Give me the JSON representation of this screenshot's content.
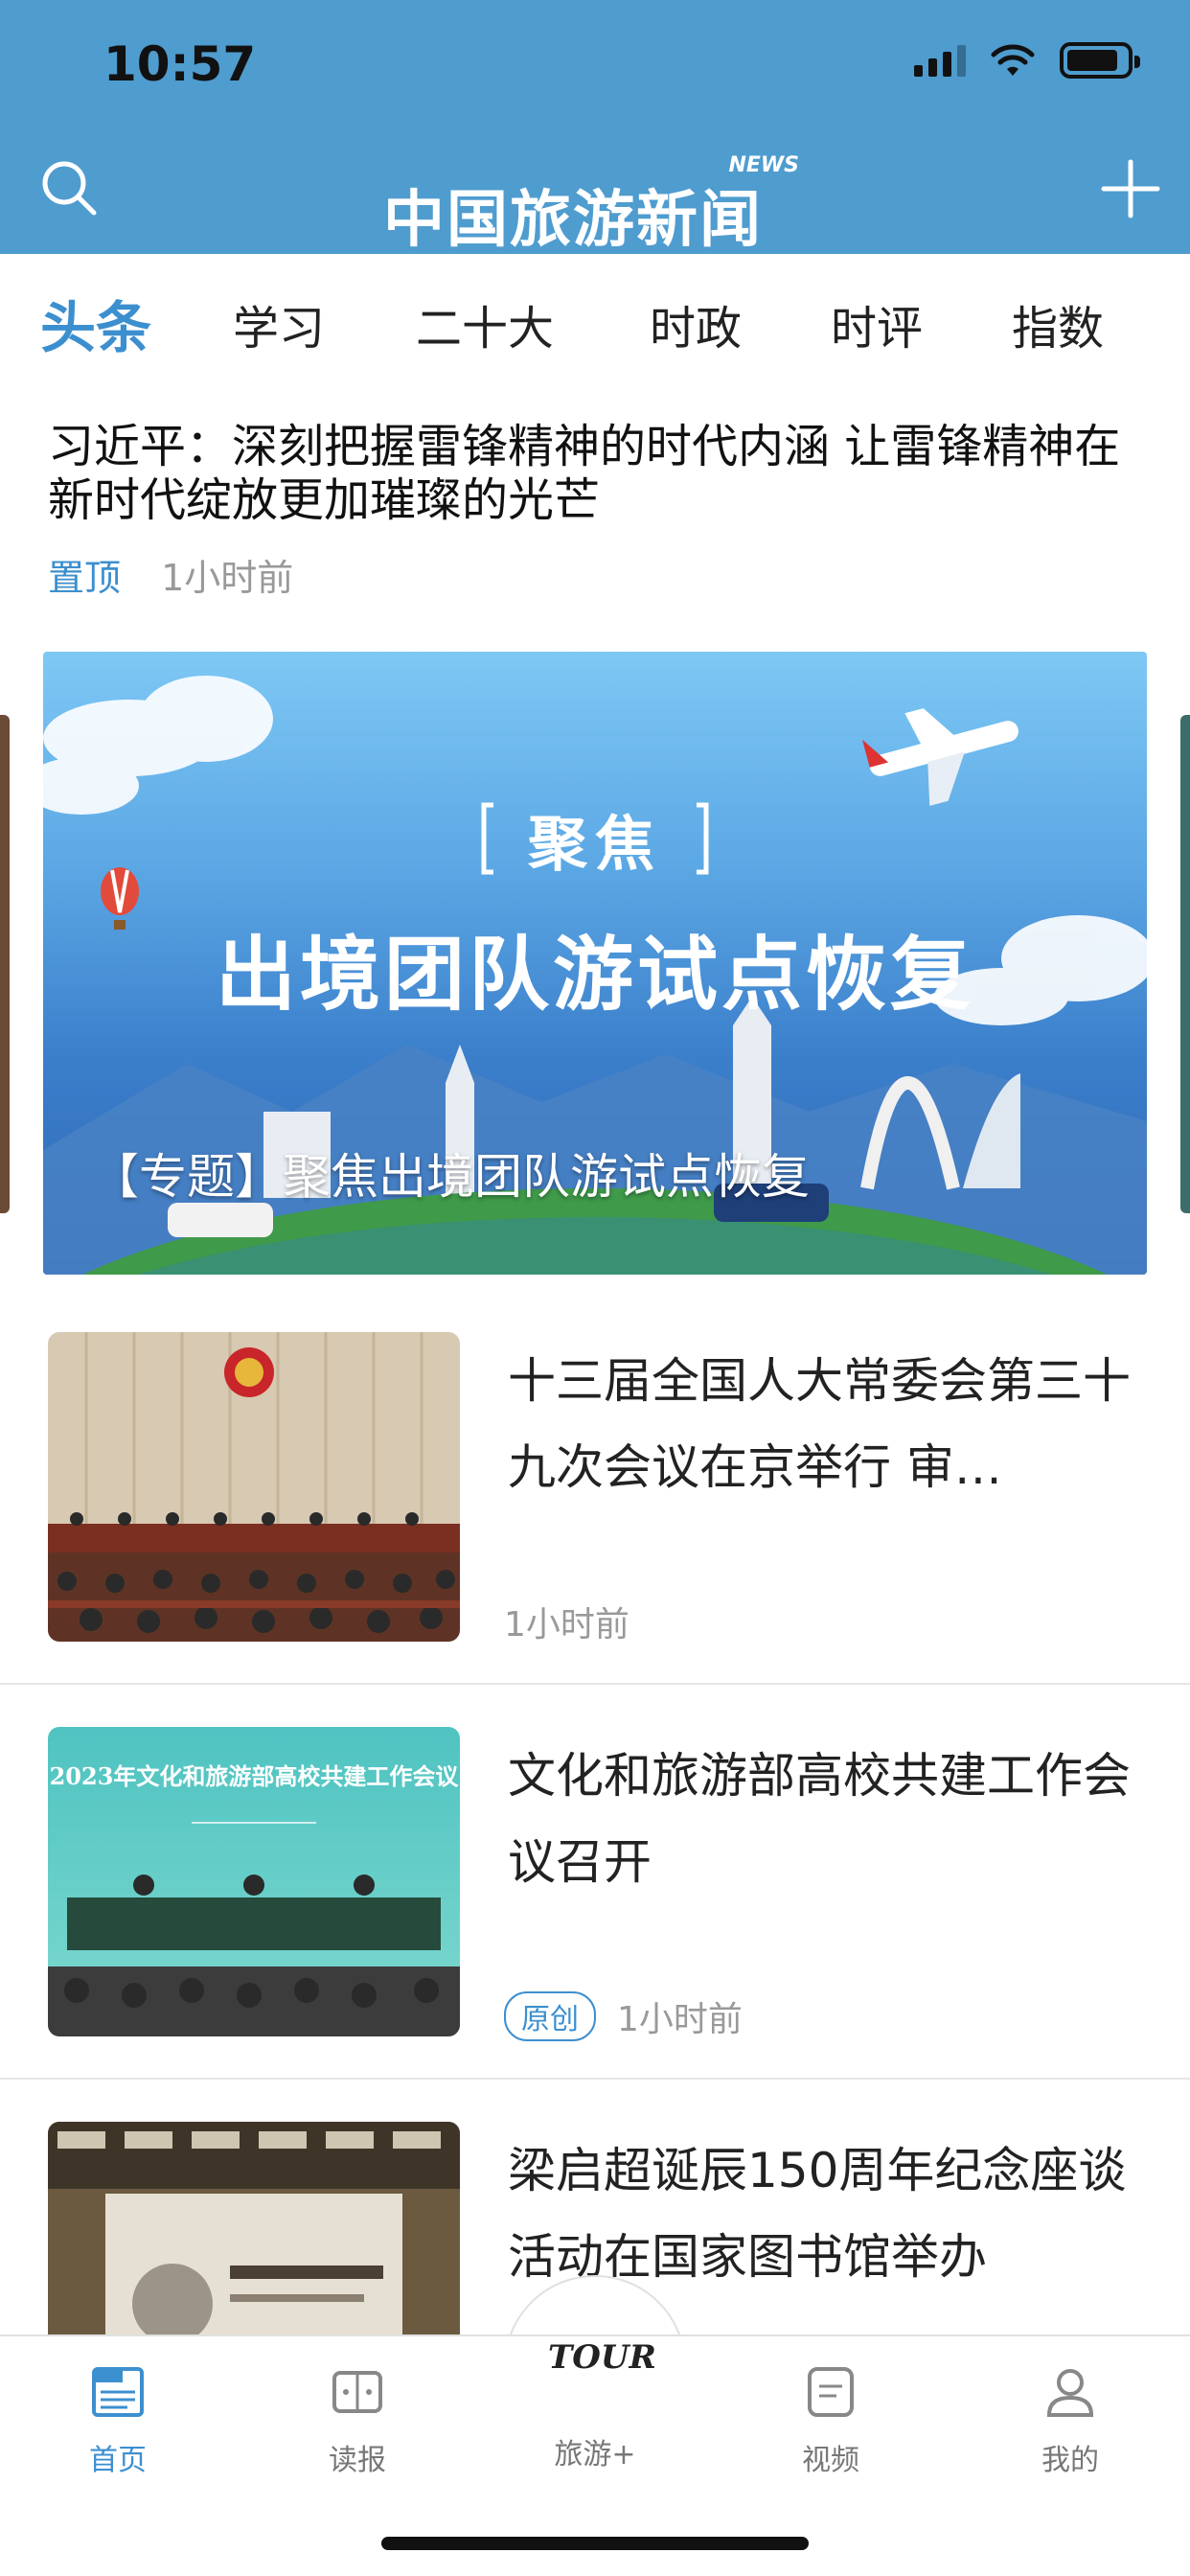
{
  "status_bar": {
    "time": "10:57"
  },
  "header": {
    "logo_text": "中国旅游新闻",
    "logo_badge": "NEWS"
  },
  "tabs": [
    "头条",
    "学习",
    "二十大",
    "时政",
    "时评",
    "指数"
  ],
  "pinned": {
    "title": "习近平：深刻把握雷锋精神的时代内涵 让雷锋精神在新时代绽放更加璀璨的光芒",
    "tag": "置顶",
    "time": "1小时前"
  },
  "banner": {
    "kicker": "聚焦",
    "headline": "出境团队游试点恢复",
    "caption": "【专题】聚焦出境团队游试点恢复"
  },
  "news": [
    {
      "title": "十三届全国人大常委会第三十九次会议在京举行 审…",
      "badge": "",
      "time": "1小时前"
    },
    {
      "title": "文化和旅游部高校共建工作会议召开",
      "badge": "原创",
      "time": "1小时前",
      "thumb_text": "2023年文化和旅游部高校共建工作会议"
    },
    {
      "title": "梁启超诞辰150周年纪念座谈活动在国家图书馆举办",
      "badge": "",
      "time": ""
    }
  ],
  "bottom_nav": {
    "home": "首页",
    "reader": "读报",
    "tour": "旅游+",
    "tour_logo": "TOUR",
    "video": "视频",
    "mine": "我的"
  },
  "colors": {
    "header_bg": "#4f9ccf",
    "accent": "#3c8fcf"
  }
}
